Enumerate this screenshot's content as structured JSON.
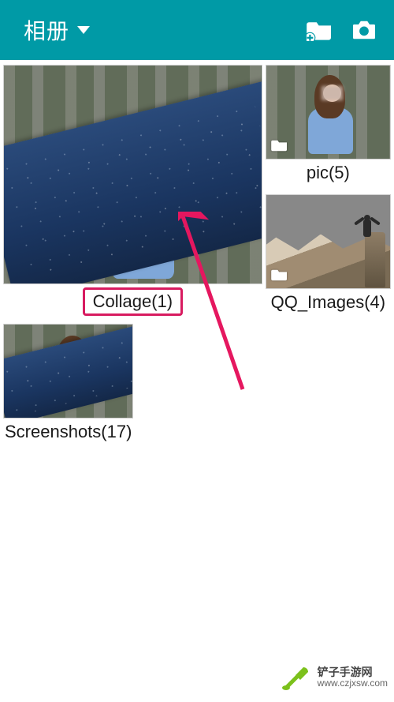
{
  "appbar": {
    "title": "相册",
    "icons": {
      "new_folder": "new-folder-icon",
      "camera": "camera-icon",
      "dropdown": "dropdown-icon"
    }
  },
  "albums": [
    {
      "id": "collage",
      "label": "Collage(1)",
      "highlighted": true
    },
    {
      "id": "pic",
      "label": "pic(5)",
      "highlighted": false
    },
    {
      "id": "qq_images",
      "label": "QQ_Images(4)",
      "highlighted": false
    },
    {
      "id": "screenshots",
      "label": "Screenshots(17)",
      "highlighted": false
    }
  ],
  "watermark": {
    "site_name_cn": "铲子手游网",
    "site_url": "www.czjxsw.com"
  },
  "annotation": {
    "arrow_color": "#e5175f"
  }
}
